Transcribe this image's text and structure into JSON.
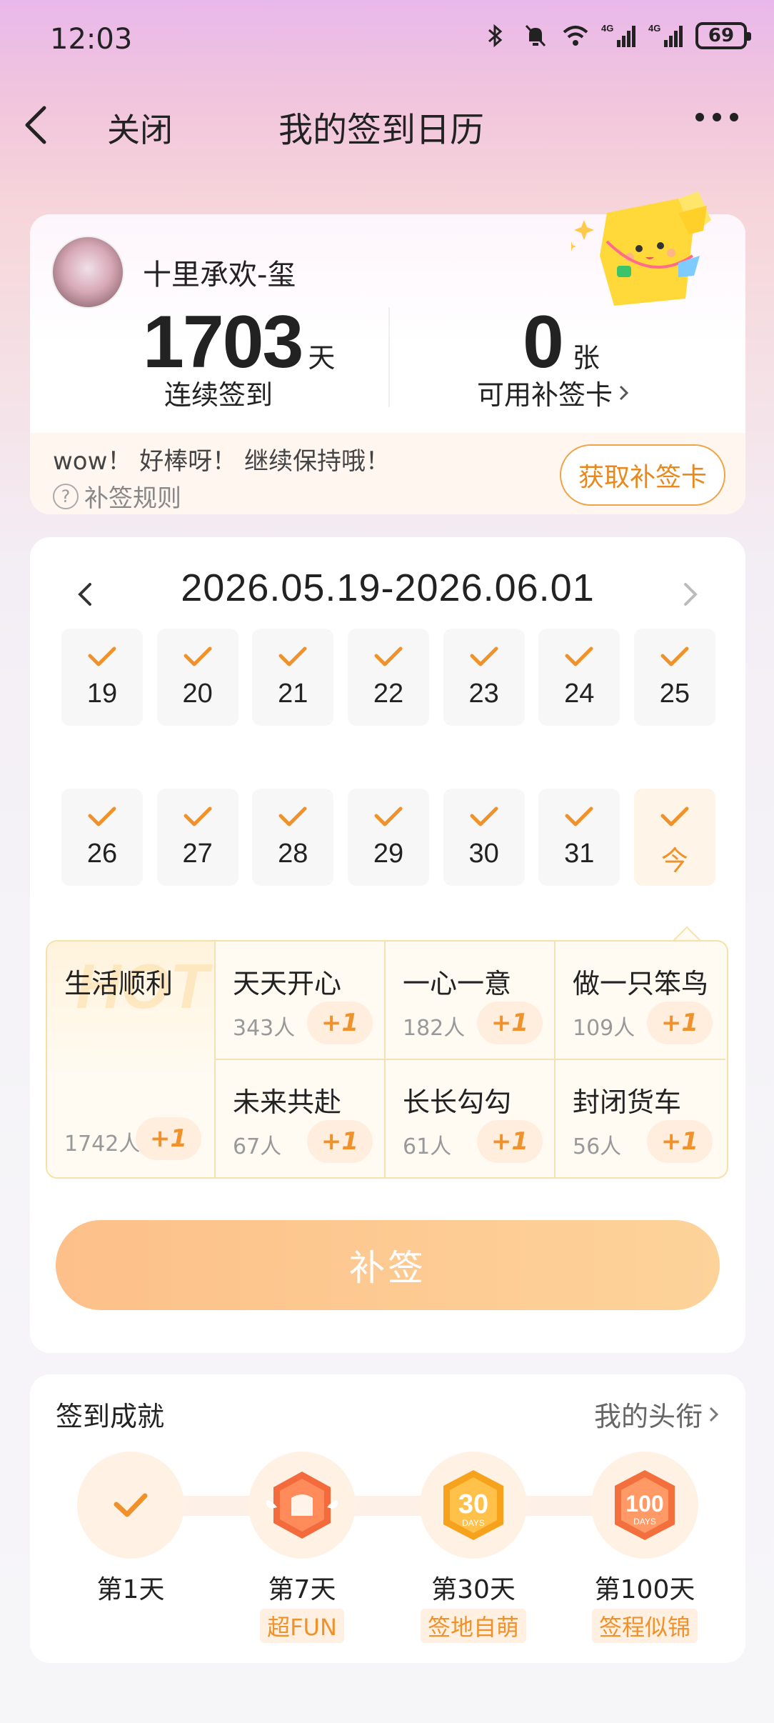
{
  "status_bar": {
    "time": "12:03",
    "battery": "69",
    "network_1": "4G",
    "network_2": "4G"
  },
  "nav": {
    "close_label": "关闭",
    "title": "我的签到日历"
  },
  "profile": {
    "username": "十里承欢-玺",
    "streak_days": "1703",
    "streak_unit": "天",
    "streak_label": "连续签到",
    "cards_count": "0",
    "cards_unit": "张",
    "cards_label": "可用补签卡",
    "encourage_text": "wow！ 好棒呀！ 继续保持哦！",
    "rules_label": "补签规则",
    "get_card_button": "获取补签卡"
  },
  "calendar": {
    "range": "2026.05.19-2026.06.01",
    "week1": [
      "19",
      "20",
      "21",
      "22",
      "23",
      "24",
      "25"
    ],
    "week2": [
      "26",
      "27",
      "28",
      "29",
      "30",
      "31",
      "今"
    ],
    "checked": true
  },
  "mood_tags": {
    "hot_watermark": "HOT",
    "featured": {
      "name": "生活顺利",
      "count": "1742人",
      "plus": "+1"
    },
    "items": [
      {
        "name": "天天开心",
        "count": "343人",
        "plus": "+1"
      },
      {
        "name": "一心一意",
        "count": "182人",
        "plus": "+1"
      },
      {
        "name": "做一只笨鸟",
        "count": "109人",
        "plus": "+1"
      },
      {
        "name": "未来共赴",
        "count": "67人",
        "plus": "+1"
      },
      {
        "name": "长长勾勾",
        "count": "61人",
        "plus": "+1"
      },
      {
        "name": "封闭货车",
        "count": "56人",
        "plus": "+1"
      }
    ]
  },
  "supplement_button": "补签",
  "achievements": {
    "title": "签到成就",
    "link": "我的头衔",
    "items": [
      {
        "label": "第1天",
        "tag": ""
      },
      {
        "label": "第7天",
        "tag": "超FUN"
      },
      {
        "label": "第30天",
        "tag": "签地自萌"
      },
      {
        "label": "第100天",
        "tag": "签程似锦"
      }
    ]
  },
  "colors": {
    "accent": "#f0922b",
    "accent_light": "#fdc08a",
    "border_gold": "#f6e2a8"
  }
}
